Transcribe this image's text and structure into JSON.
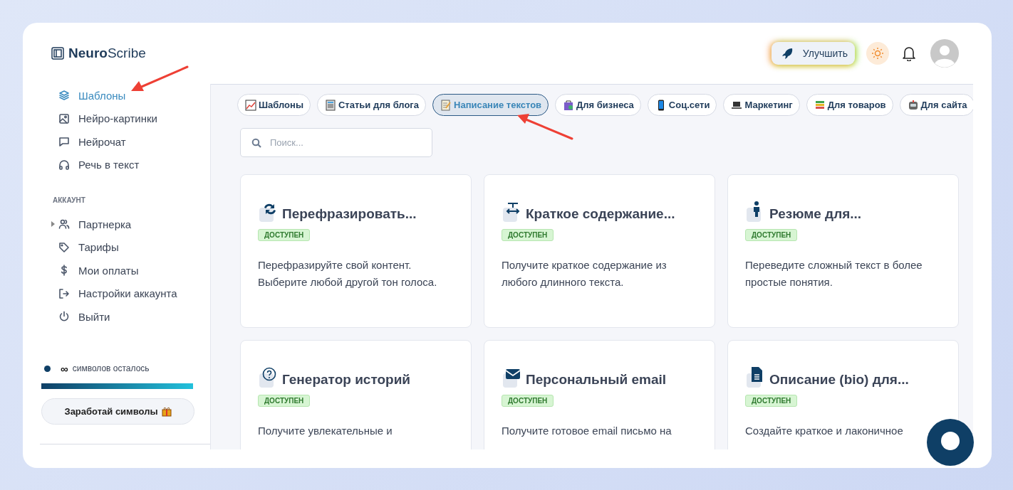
{
  "header": {
    "logo": {
      "bold": "Neuro",
      "rest": "Scribe"
    },
    "upgrade_button": "Улучшить"
  },
  "sidebar": {
    "items": [
      {
        "label": "Шаблоны",
        "selected": true
      },
      {
        "label": "Нейро-картинки",
        "selected": false
      },
      {
        "label": "Нейрочат",
        "selected": false
      },
      {
        "label": "Речь в текст",
        "selected": false
      }
    ],
    "section_title": "АККАУНТ",
    "account_items": [
      {
        "label": "Партнерка",
        "expandable": true
      },
      {
        "label": "Тарифы",
        "expandable": false
      },
      {
        "label": "Мои оплаты",
        "expandable": false
      },
      {
        "label": "Настройки аккаунта",
        "expandable": false
      },
      {
        "label": "Выйти",
        "expandable": false
      }
    ],
    "credits": {
      "amount": "∞",
      "label": "символов осталось",
      "level": 1
    },
    "earn_button": "Заработай символы"
  },
  "categories": [
    {
      "label": "Шаблоны",
      "selected": false
    },
    {
      "label": "Статьи для блога",
      "selected": false
    },
    {
      "label": "Написание текстов",
      "selected": true
    },
    {
      "label": "Для бизнеса",
      "selected": false
    },
    {
      "label": "Соц.сети",
      "selected": false
    },
    {
      "label": "Маркетинг",
      "selected": false
    },
    {
      "label": "Для товаров",
      "selected": false
    },
    {
      "label": "Для сайта",
      "selected": false
    }
  ],
  "search": {
    "placeholder": "Поиск..."
  },
  "cards": [
    {
      "title": "Перефразировать...",
      "status": "ДОСТУПЕН",
      "description": "Перефразируйте свой контент. Выберите любой другой тон голоса."
    },
    {
      "title": "Краткое содержание...",
      "status": "ДОСТУПЕН",
      "description": "Получите краткое содержание из любого длинного текста."
    },
    {
      "title": "Резюме для...",
      "status": "ДОСТУПЕН",
      "description": "Переведите сложный текст в более простые понятия."
    },
    {
      "title": "Генератор историй",
      "status": "ДОСТУПЕН",
      "description": "Получите увлекательные и"
    },
    {
      "title": "Персональный email",
      "status": "ДОСТУПЕН",
      "description": "Получите готовое email письмо на"
    },
    {
      "title": "Описание (bio) для...",
      "status": "ДОСТУПЕН",
      "description": "Создайте краткое и лаконичное"
    }
  ]
}
